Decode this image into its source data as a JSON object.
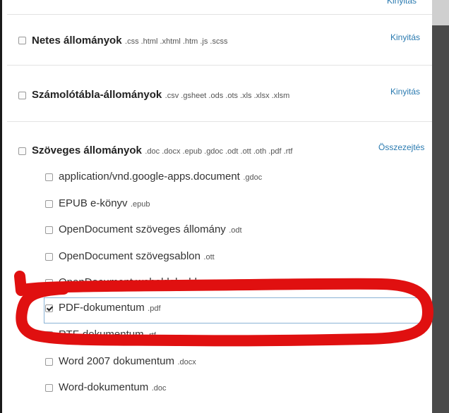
{
  "top_partial_action": "Kinyitás",
  "categories": [
    {
      "name": "Netes állományok",
      "ext": ".css .html .xhtml .htm .js .scss",
      "action": "Kinyitás"
    },
    {
      "name": "Számolótábla-állományok",
      "ext": ".csv .gsheet .ods .ots .xls .xlsx .xlsm",
      "action": "Kinyitás"
    },
    {
      "name": "Szöveges állományok",
      "ext": ".doc .docx .epub .gdoc .odt .ott .oth .pdf .rtf",
      "action": "Összezejtés"
    }
  ],
  "subitems": [
    {
      "name": "application/vnd.google-apps.document",
      "ext": ".gdoc",
      "checked": false
    },
    {
      "name": "EPUB e-könyv",
      "ext": ".epub",
      "checked": false
    },
    {
      "name": "OpenDocument szöveges állomány",
      "ext": ".odt",
      "checked": false
    },
    {
      "name": "OpenDocument szövegsablon",
      "ext": ".ott",
      "checked": false
    },
    {
      "name": "OpenDocument weboldalsablon",
      "ext": ".oth",
      "checked": false
    },
    {
      "name": "PDF-dokumentum",
      "ext": ".pdf",
      "checked": true
    },
    {
      "name": "RTF-dokumentum",
      "ext": ".rtf",
      "checked": false
    },
    {
      "name": "Word 2007 dokumentum",
      "ext": ".docx",
      "checked": false
    },
    {
      "name": "Word-dokumentum",
      "ext": ".doc",
      "checked": false
    }
  ],
  "annotation_color": "#e01010"
}
